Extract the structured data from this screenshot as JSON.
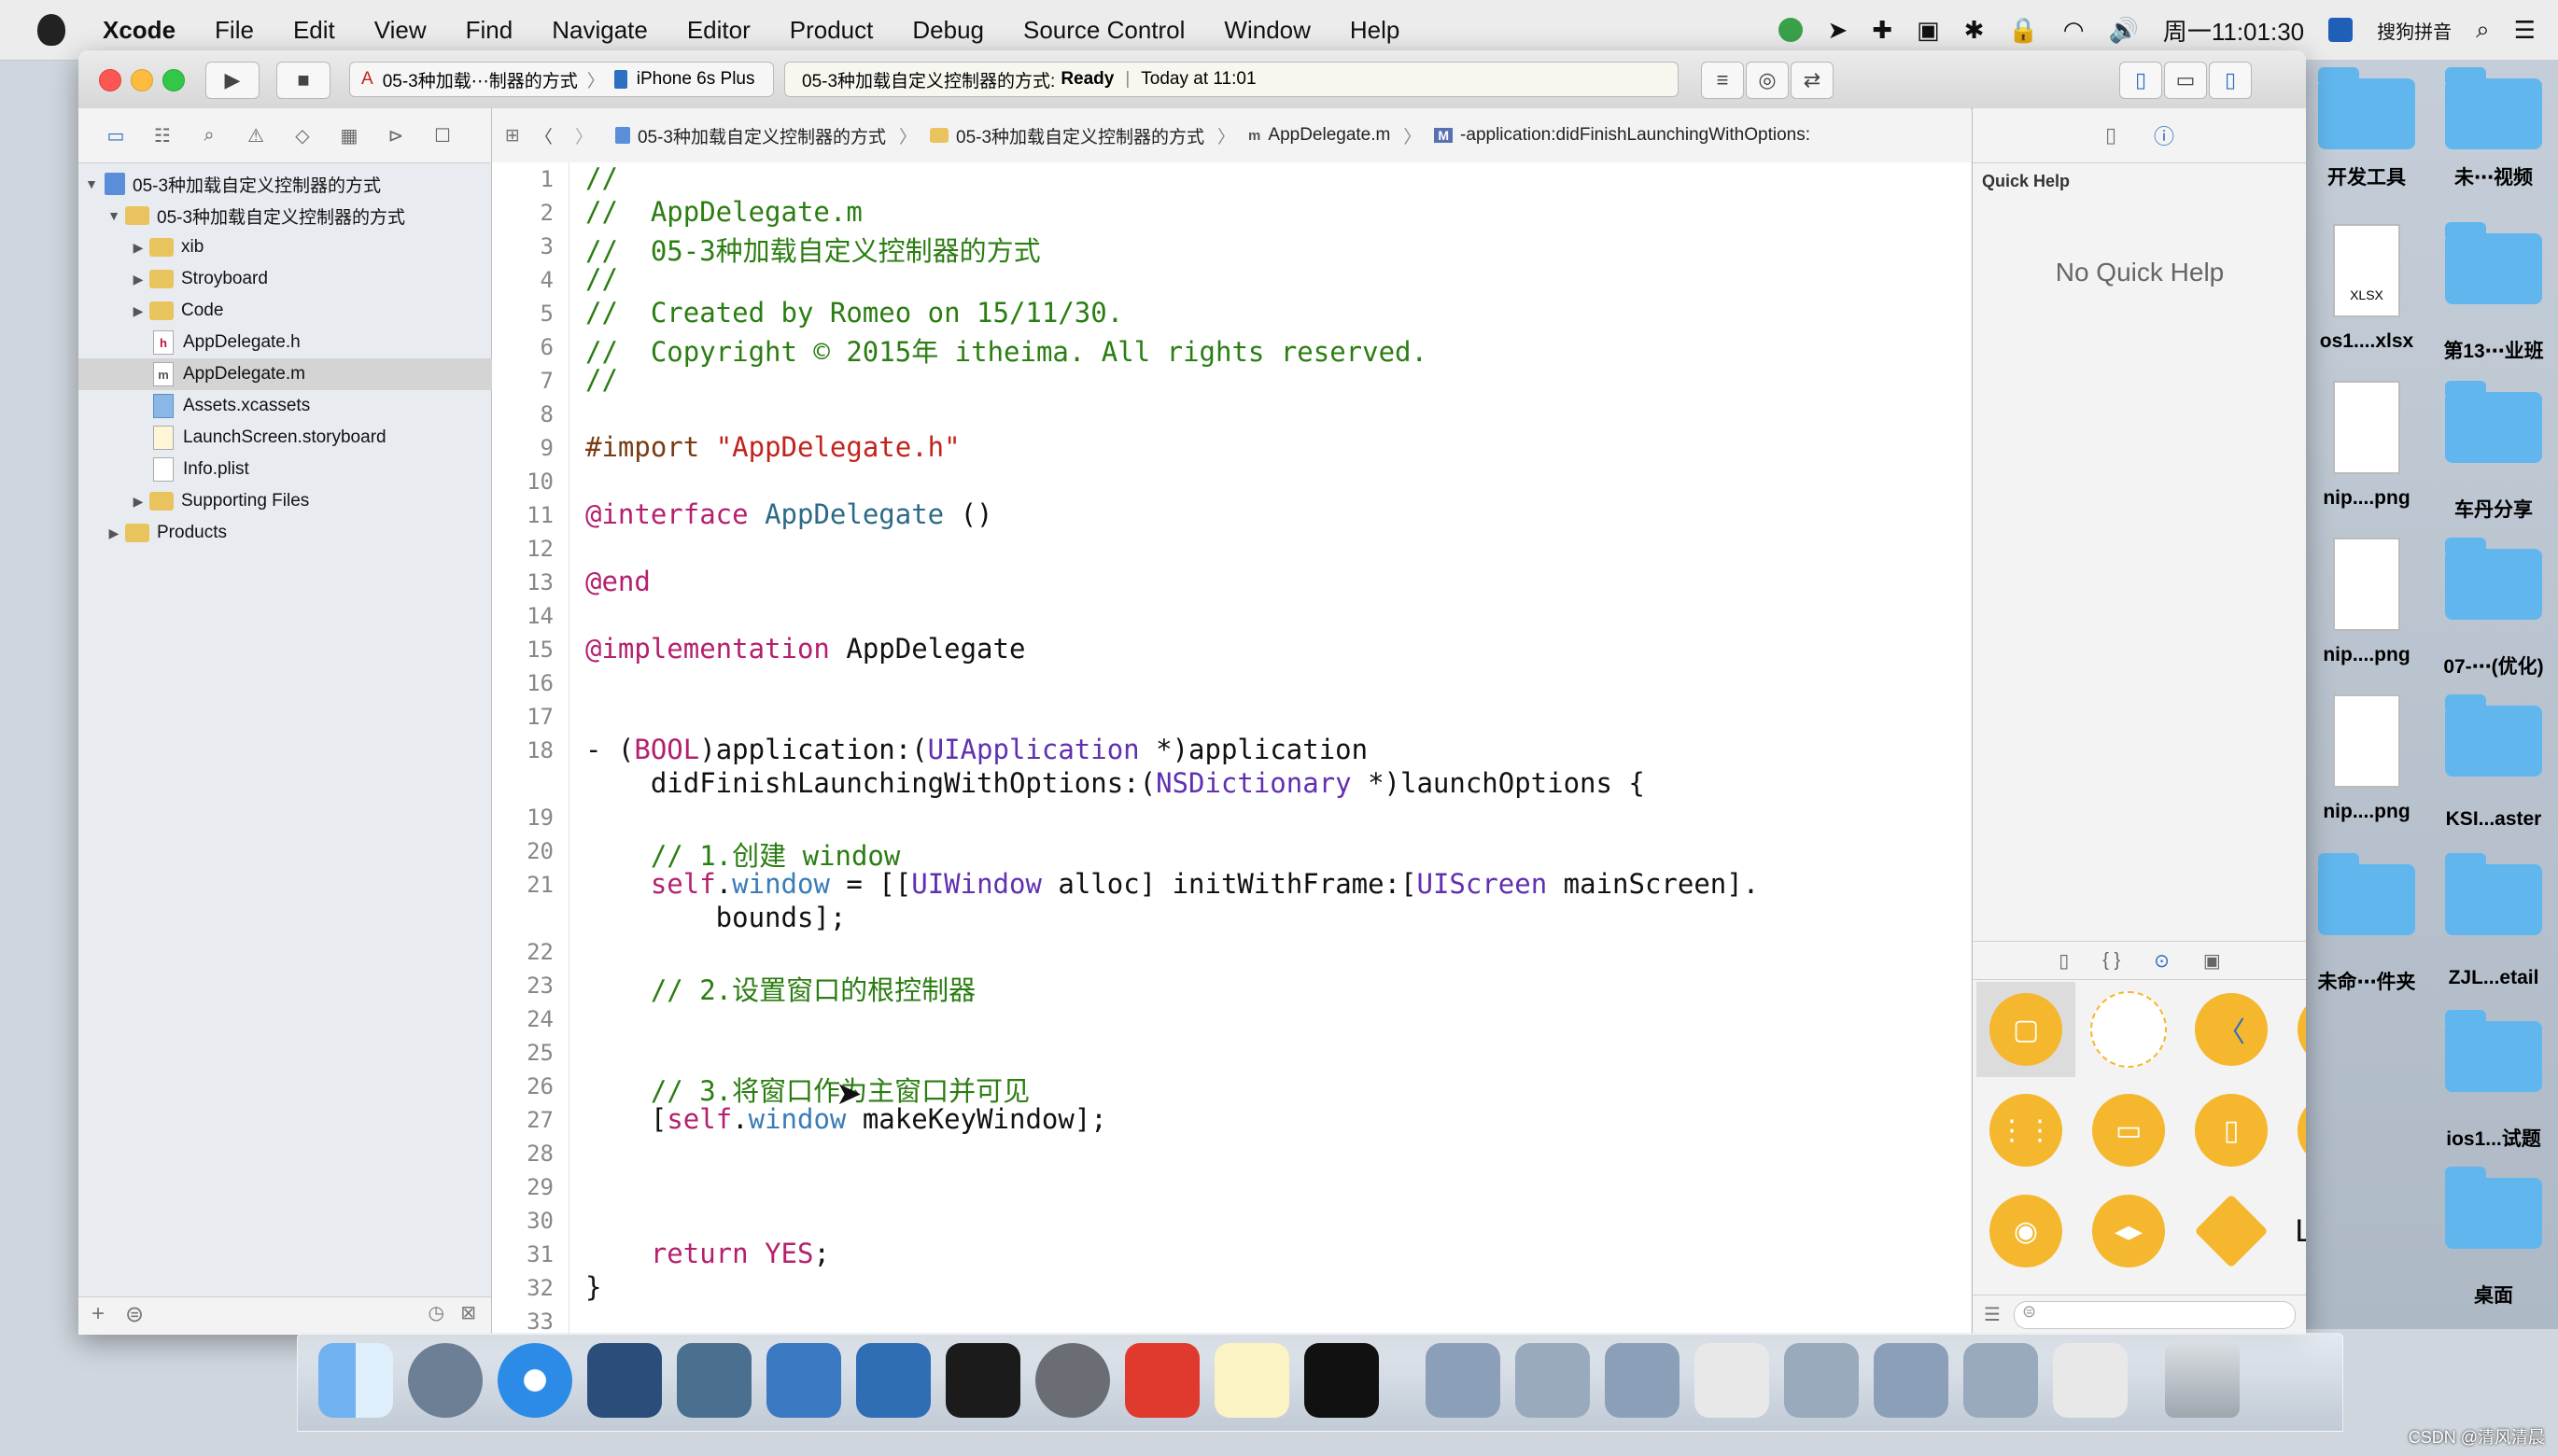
{
  "menubar": {
    "items": [
      "Xcode",
      "File",
      "Edit",
      "View",
      "Find",
      "Navigate",
      "Editor",
      "Product",
      "Debug",
      "Source Control",
      "Window",
      "Help"
    ],
    "clock": "周一11:01:30",
    "input_method": "搜狗拼音"
  },
  "toolbar": {
    "scheme_target": "05-3种加载⋯制器的方式",
    "device": "iPhone 6s Plus",
    "activity_project": "05-3种加载自定义控制器的方式:",
    "activity_status": "Ready",
    "activity_time": "Today at 11:01"
  },
  "navigator": {
    "rows": [
      {
        "label": "05-3种加载自定义控制器的方式",
        "kind": "project"
      },
      {
        "label": "05-3种加载自定义控制器的方式",
        "kind": "folder"
      },
      {
        "label": "xib",
        "kind": "folder"
      },
      {
        "label": "Stroyboard",
        "kind": "folder"
      },
      {
        "label": "Code",
        "kind": "folder"
      },
      {
        "label": "AppDelegate.h",
        "kind": "h"
      },
      {
        "label": "AppDelegate.m",
        "kind": "m"
      },
      {
        "label": "Assets.xcassets",
        "kind": "assets"
      },
      {
        "label": "LaunchScreen.storyboard",
        "kind": "storyboard"
      },
      {
        "label": "Info.plist",
        "kind": "plist"
      },
      {
        "label": "Supporting Files",
        "kind": "folder"
      },
      {
        "label": "Products",
        "kind": "folder"
      }
    ]
  },
  "jumpbar": {
    "project": "05-3种加载自定义控制器的方式",
    "group": "05-3种加载自定义控制器的方式",
    "file": "AppDelegate.m",
    "method": "-application:didFinishLaunchingWithOptions:"
  },
  "editor": {
    "line_numbers": [
      "1",
      "2",
      "3",
      "4",
      "5",
      "6",
      "7",
      "8",
      "9",
      "10",
      "11",
      "12",
      "13",
      "14",
      "15",
      "16",
      "17",
      "18",
      "19",
      "20",
      "21",
      "22",
      "23",
      "24",
      "25",
      "26",
      "27",
      "28",
      "29",
      "30",
      "31",
      "32",
      "33"
    ],
    "lines": {
      "l1": "//",
      "l2": "//  AppDelegate.m",
      "l3": "//  05-3种加载自定义控制器的方式",
      "l4": "//",
      "l5": "//  Created by Romeo on 15/11/30.",
      "l6": "//  Copyright © 2015年 itheima. All rights reserved.",
      "l7": "//",
      "l9a": "#import ",
      "l9b": "\"AppDelegate.h\"",
      "l11a": "@interface",
      "l11b": "AppDelegate",
      "l11c": " ()",
      "l13": "@end",
      "l15a": "@implementation",
      "l15b": " AppDelegate",
      "l18a": "- (",
      "l18b": "BOOL",
      "l18c": ")application:(",
      "l18d": "UIApplication",
      "l18e": " *)application",
      "l18f": "    didFinishLaunchingWithOptions:(",
      "l18g": "NSDictionary",
      "l18h": " *)launchOptions {",
      "l20": "    // 1.创建 window",
      "l21a": "    ",
      "l21b": "self",
      "l21c": ".",
      "l21d": "window",
      "l21e": " = [[",
      "l21f": "UIWindow",
      "l21g": " alloc] initWithFrame:[",
      "l21h": "UIScreen",
      "l21i": " mainScreen].",
      "l21j": "        bounds];",
      "l23": "    // 2.设置窗口的根控制器",
      "l26": "    // 3.将窗口作为主窗口并可见",
      "l27a": "    [",
      "l27b": "self",
      "l27c": ".",
      "l27d": "window",
      "l27e": " makeKeyWindow];",
      "l31a": "    ",
      "l31b": "return",
      "l31c": " YES",
      "l31d": ";",
      "l32": "}"
    }
  },
  "inspector": {
    "quick_help_title": "Quick Help",
    "quick_help_empty": "No Quick Help",
    "library_label_item": "Label"
  },
  "desktop": {
    "items": [
      "开发工具",
      "未⋯视频",
      "os1....xlsx",
      "第13⋯业班",
      "nip....png",
      "车丹分享",
      "nip....png",
      "07-⋯(优化)",
      "nip....png",
      "KSI...aster",
      "未命⋯件夹",
      "ZJL...etail",
      "ios1...试题",
      "桌面"
    ],
    "xlsx_badge": "XLSX"
  },
  "watermark": "CSDN @清风清晨",
  "colors": {
    "comment": "#2b7d12",
    "keyword": "#b4206e",
    "type": "#6030b0",
    "string": "#c2231c",
    "property": "#3a7cb8",
    "library_accent": "#f5b72e"
  }
}
